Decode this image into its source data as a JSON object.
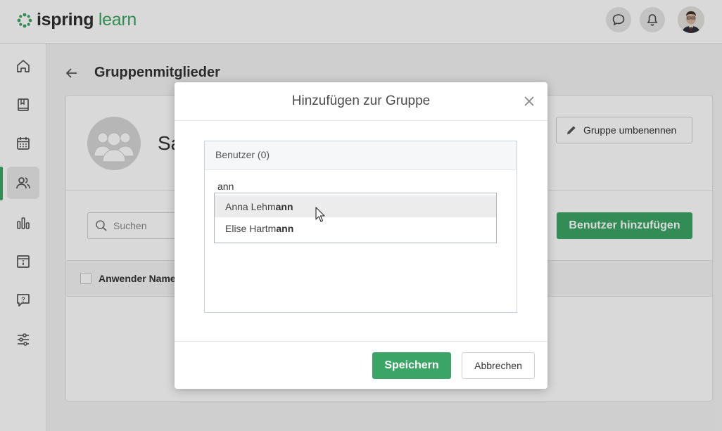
{
  "header": {
    "logo_part1": "ispring",
    "logo_part2": "learn",
    "chat_icon": "chat-bubble-icon",
    "notifications_icon": "bell-icon"
  },
  "sidebar": {
    "items": [
      {
        "icon": "home-icon"
      },
      {
        "icon": "book-icon"
      },
      {
        "icon": "calendar-icon"
      },
      {
        "icon": "users-icon",
        "active": true
      },
      {
        "icon": "bar-chart-icon"
      },
      {
        "icon": "info-archive-icon"
      },
      {
        "icon": "help-chat-icon"
      },
      {
        "icon": "sliders-icon"
      }
    ]
  },
  "page": {
    "title": "Gruppenmitglieder",
    "group_name": "Sa",
    "rename_button": "Gruppe umbenennen",
    "search_placeholder": "Suchen",
    "add_user_button": "Benutzer hinzufügen",
    "table_header_name": "Anwender Name"
  },
  "modal": {
    "title": "Hinzufügen zur Gruppe",
    "users_header": "Benutzer (0)",
    "input_value": "ann",
    "suggestions": [
      {
        "prefix": "Anna Lehm",
        "match": "ann",
        "suffix": ""
      },
      {
        "prefix": "Elise Hartm",
        "match": "ann",
        "suffix": ""
      }
    ],
    "save_button": "Speichern",
    "cancel_button": "Abbrechen"
  },
  "colors": {
    "accent": "#3aa564",
    "overlay": "rgba(0,0,0,0.15)"
  }
}
